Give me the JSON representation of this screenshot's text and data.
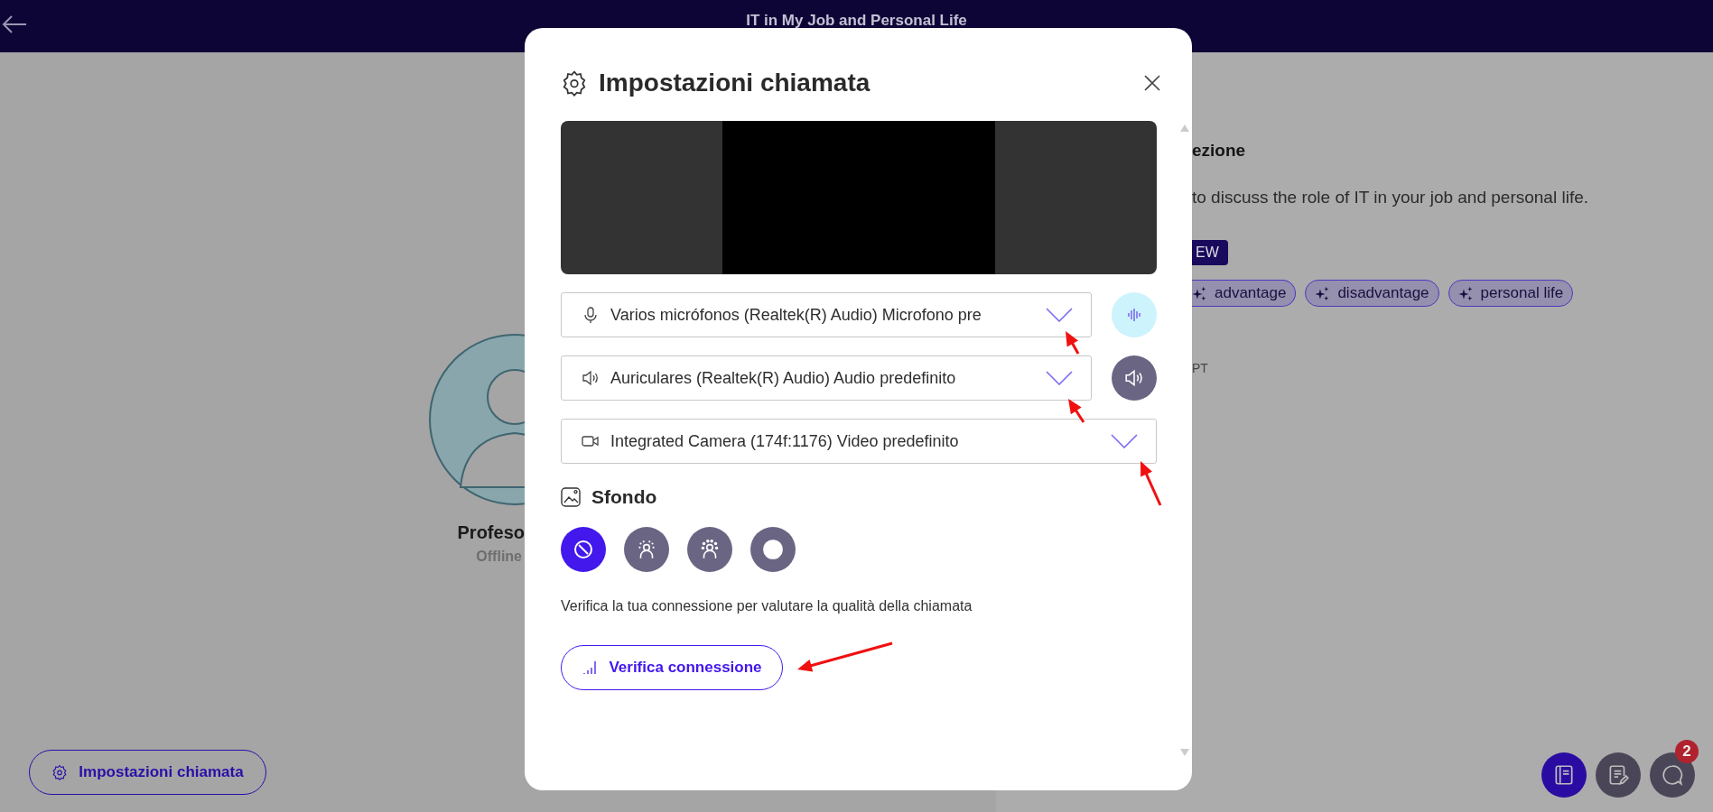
{
  "top_bar": {
    "title": "IT in My Job and Personal Life"
  },
  "profile": {
    "name": "Profeso",
    "status": "Offline"
  },
  "settings_button": {
    "label": "Impostazioni chiamata"
  },
  "lesson": {
    "heading": "ezione",
    "description": "to discuss the role of IT in your job and personal life.",
    "badge": "EW",
    "tags": [
      "advantage",
      "disadvantage",
      "personal life"
    ],
    "footer": "PT"
  },
  "floating_buttons": [
    {
      "kind": "book",
      "selected": true
    },
    {
      "kind": "notes",
      "selected": false
    },
    {
      "kind": "chat",
      "selected": false,
      "badge": "2"
    }
  ],
  "dialog": {
    "title": "Impostazioni chiamata",
    "devices": [
      {
        "kind": "microphone",
        "value": "Varios micrófonos (Realtek(R) Audio) Microfono pre",
        "test_active": true
      },
      {
        "kind": "speaker",
        "value": "Auriculares (Realtek(R) Audio) Audio predefinito",
        "test_active": false
      },
      {
        "kind": "camera",
        "value": "Integrated Camera (174f:1176) Video predefinito"
      }
    ],
    "background_section": {
      "title": "Sfondo",
      "options": [
        {
          "kind": "none",
          "selected": true
        },
        {
          "kind": "blur_light",
          "selected": false
        },
        {
          "kind": "blur_strong",
          "selected": false
        },
        {
          "kind": "image",
          "selected": false
        }
      ]
    },
    "connection_hint": "Verifica la tua connessione per valutare la qualità della chiamata",
    "check_button": "Verifica connessione"
  }
}
